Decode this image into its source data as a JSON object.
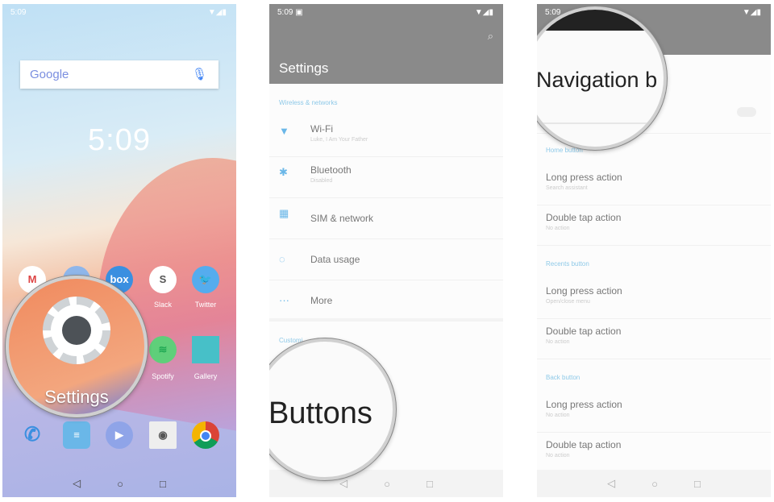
{
  "panel1": {
    "status_time": "5:09",
    "search_logo": "Google",
    "clock": "5:09",
    "apps": [
      {
        "name": "Gmail",
        "label": "",
        "color": "#ffffff"
      },
      {
        "name": "Contacts",
        "label": "",
        "color": "#8fb6ea"
      },
      {
        "name": "Box",
        "label": "",
        "text": "box",
        "color": "#3a8fe0"
      },
      {
        "name": "Slack",
        "label": "Slack",
        "text": "S",
        "color": "#ffffff"
      },
      {
        "name": "Twitter",
        "label": "Twitter",
        "color": "#55acee"
      },
      {
        "name": "Spotify",
        "label": "Spotify",
        "color": "#5fcf7a"
      },
      {
        "name": "Gallery",
        "label": "Gallery",
        "color": "#47c0c8"
      }
    ],
    "dock": [
      "phone",
      "messages",
      "duo",
      "camera",
      "chrome"
    ],
    "magnifier_label": "Settings"
  },
  "panel2": {
    "status_time": "5:09",
    "title": "Settings",
    "section": "Wireless & networks",
    "items": [
      {
        "icon": "wifi-icon",
        "title": "Wi-Fi",
        "subtitle": "Luke, I Am Your Father"
      },
      {
        "icon": "bluetooth-icon",
        "title": "Bluetooth",
        "subtitle": "Disabled"
      },
      {
        "icon": "sim-icon",
        "title": "SIM & network",
        "subtitle": ""
      },
      {
        "icon": "data-usage-icon",
        "title": "Data usage",
        "subtitle": ""
      },
      {
        "icon": "more-icon",
        "title": "More",
        "subtitle": ""
      }
    ],
    "section2": "Customi",
    "magnifier_label": "Buttons"
  },
  "panel3": {
    "status_time": "5:09",
    "magnifier_label": "Navigation b",
    "groups": [
      {
        "header": "Home button",
        "items": [
          {
            "title": "Long press action",
            "subtitle": "Search assistant"
          },
          {
            "title": "Double tap action",
            "subtitle": "No action"
          }
        ]
      },
      {
        "header": "Recents button",
        "items": [
          {
            "title": "Long press action",
            "subtitle": "Open/close menu"
          },
          {
            "title": "Double tap action",
            "subtitle": "No action"
          }
        ]
      },
      {
        "header": "Back button",
        "items": [
          {
            "title": "Long press action",
            "subtitle": "No action"
          },
          {
            "title": "Double tap action",
            "subtitle": "No action"
          }
        ]
      }
    ]
  },
  "nav": {
    "back": "◁",
    "home": "○",
    "recents": "□"
  },
  "colors": {
    "accent": "#8ec9e8",
    "header": "#8a8a8a"
  }
}
